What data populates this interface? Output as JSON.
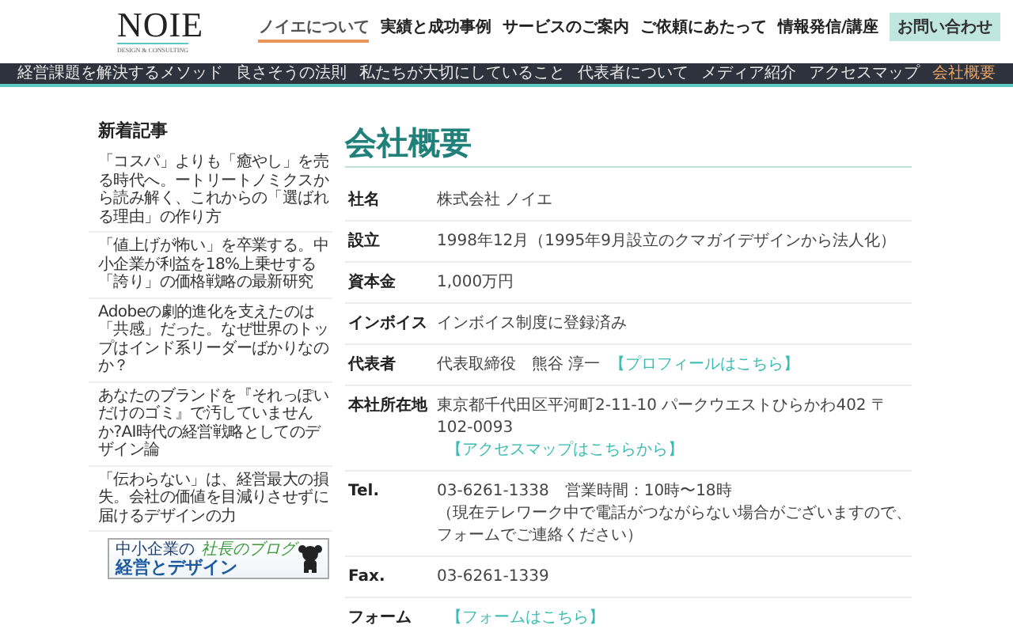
{
  "header": {
    "logo": {
      "name": "NOIE",
      "tagline": "DESIGN & CONSULTING"
    },
    "nav": [
      {
        "label": "ノイエについて",
        "selected": true
      },
      {
        "label": "実績と成功事例",
        "selected": false
      },
      {
        "label": "サービスのご案内",
        "selected": false
      },
      {
        "label": "ご依頼にあたって",
        "selected": false
      },
      {
        "label": "情報発信/講座",
        "selected": false
      }
    ],
    "contact_button": "お問い合わせ"
  },
  "subnav": [
    {
      "label": "経営課題を解決するメソッド",
      "selected": false
    },
    {
      "label": "良さそうの法則",
      "selected": false
    },
    {
      "label": "私たちが大切にしていること",
      "selected": false
    },
    {
      "label": "代表者について",
      "selected": false
    },
    {
      "label": "メディア紹介",
      "selected": false
    },
    {
      "label": "アクセスマップ",
      "selected": false
    },
    {
      "label": "会社概要",
      "selected": true
    }
  ],
  "sidebar": {
    "heading": "新着記事",
    "articles": [
      "「コスパ」よりも「癒やし」を売る時代へ。ートリートノミクスから読み解く、これからの「選ばれる理由」の作り方",
      "「値上げが怖い」を卒業する。中小企業が利益を18%上乗せする「誇り」の価格戦略の最新研究",
      "Adobeの劇的進化を支えたのは「共感」だった。なぜ世界のトップはインド系リーダーばかりなのか？",
      "あなたのブランドを『それっぽいだけのゴミ』で汚していませんか?AI時代の経営戦略としてのデザイン論",
      "「伝わらない」は、経営最大の損失。会社の価値を目減りさせずに届けるデザインの力"
    ],
    "banner": {
      "line_1": "中小企業の",
      "line_2": "経営とデザイン",
      "script": "社長のブログ"
    }
  },
  "main": {
    "title": "会社概要",
    "rows": [
      {
        "label": "社名",
        "lines": [
          "株式会社 ノイエ"
        ]
      },
      {
        "label": "設立",
        "lines": [
          "1998年12月（1995年9月設立のクマガイデザインから法人化）"
        ]
      },
      {
        "label": "資本金",
        "lines": [
          "1,000万円"
        ]
      },
      {
        "label": "インボイス",
        "lines": [
          "インボイス制度に登録済み"
        ]
      },
      {
        "label": "代表者",
        "lines": [
          "代表取締役　熊谷 淳一"
        ],
        "link": "【プロフィールはこちら】"
      },
      {
        "label": "本社所在地",
        "lines": [
          "東京都千代田区平河町2-11-10 パークウエストひらかわ402 〒102-0093"
        ],
        "link": "【アクセスマップはこちらから】"
      },
      {
        "label": "Tel.",
        "lines": [
          "03-6261-1338　営業時間：10時〜18時",
          "（現在テレワーク中で電話がつながらない場合がございますので、フォームでご連絡ください）"
        ]
      },
      {
        "label": "Fax.",
        "lines": [
          "03-6261-1339"
        ]
      },
      {
        "label": "フォーム",
        "lines": [],
        "link": "【フォームはこちら】"
      }
    ]
  }
}
